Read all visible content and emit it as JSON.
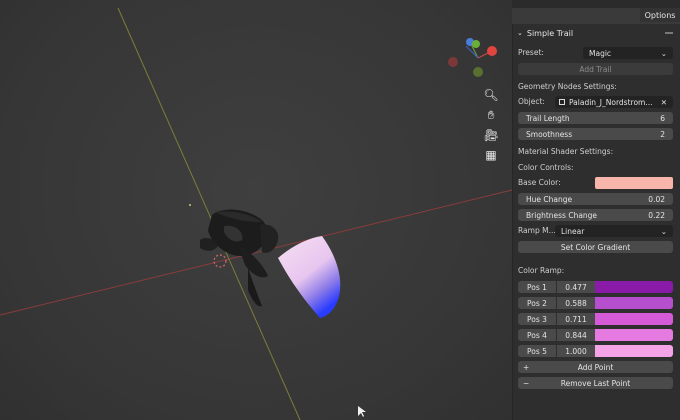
{
  "header": {
    "options_label": "Options"
  },
  "panel": {
    "title": "Simple Trail",
    "preset_label": "Preset:",
    "preset_value": "Magic",
    "add_trail_label": "Add Trail",
    "geometry_heading": "Geometry Nodes Settings:",
    "object_label": "Object:",
    "object_value": "Paladin_J_Nordstrom...",
    "trail_length": {
      "label": "Trail Length",
      "value": "6"
    },
    "smoothness": {
      "label": "Smoothness",
      "value": "2"
    },
    "material_heading": "Material Shader Settings:",
    "color_controls_heading": "Color Controls:",
    "base_color_label": "Base Color:",
    "base_color": "#f7b5ac",
    "hue_change": {
      "label": "Hue Change",
      "value": "0.02"
    },
    "brightness_change": {
      "label": "Brightness Change",
      "value": "0.22"
    },
    "ramp_mode_label": "Ramp M...",
    "ramp_mode_value": "Linear",
    "set_gradient_label": "Set Color Gradient",
    "color_ramp_heading": "Color Ramp:",
    "ramp_points": [
      {
        "label": "Pos 1",
        "value": "0.477",
        "color": "#8a1aa8"
      },
      {
        "label": "Pos 2",
        "value": "0.588",
        "color": "#b64fcd"
      },
      {
        "label": "Pos 3",
        "value": "0.711",
        "color": "#d45ad8"
      },
      {
        "label": "Pos 4",
        "value": "0.844",
        "color": "#e57ae0"
      },
      {
        "label": "Pos 5",
        "value": "1.000",
        "color": "#f5a3e7"
      }
    ],
    "add_point_label": "Add Point",
    "remove_point_label": "Remove Last Point"
  },
  "icons": {
    "zoom": "magnifier-icon",
    "pan": "hand-icon",
    "camera": "camera-icon",
    "grid": "grid-icon"
  }
}
